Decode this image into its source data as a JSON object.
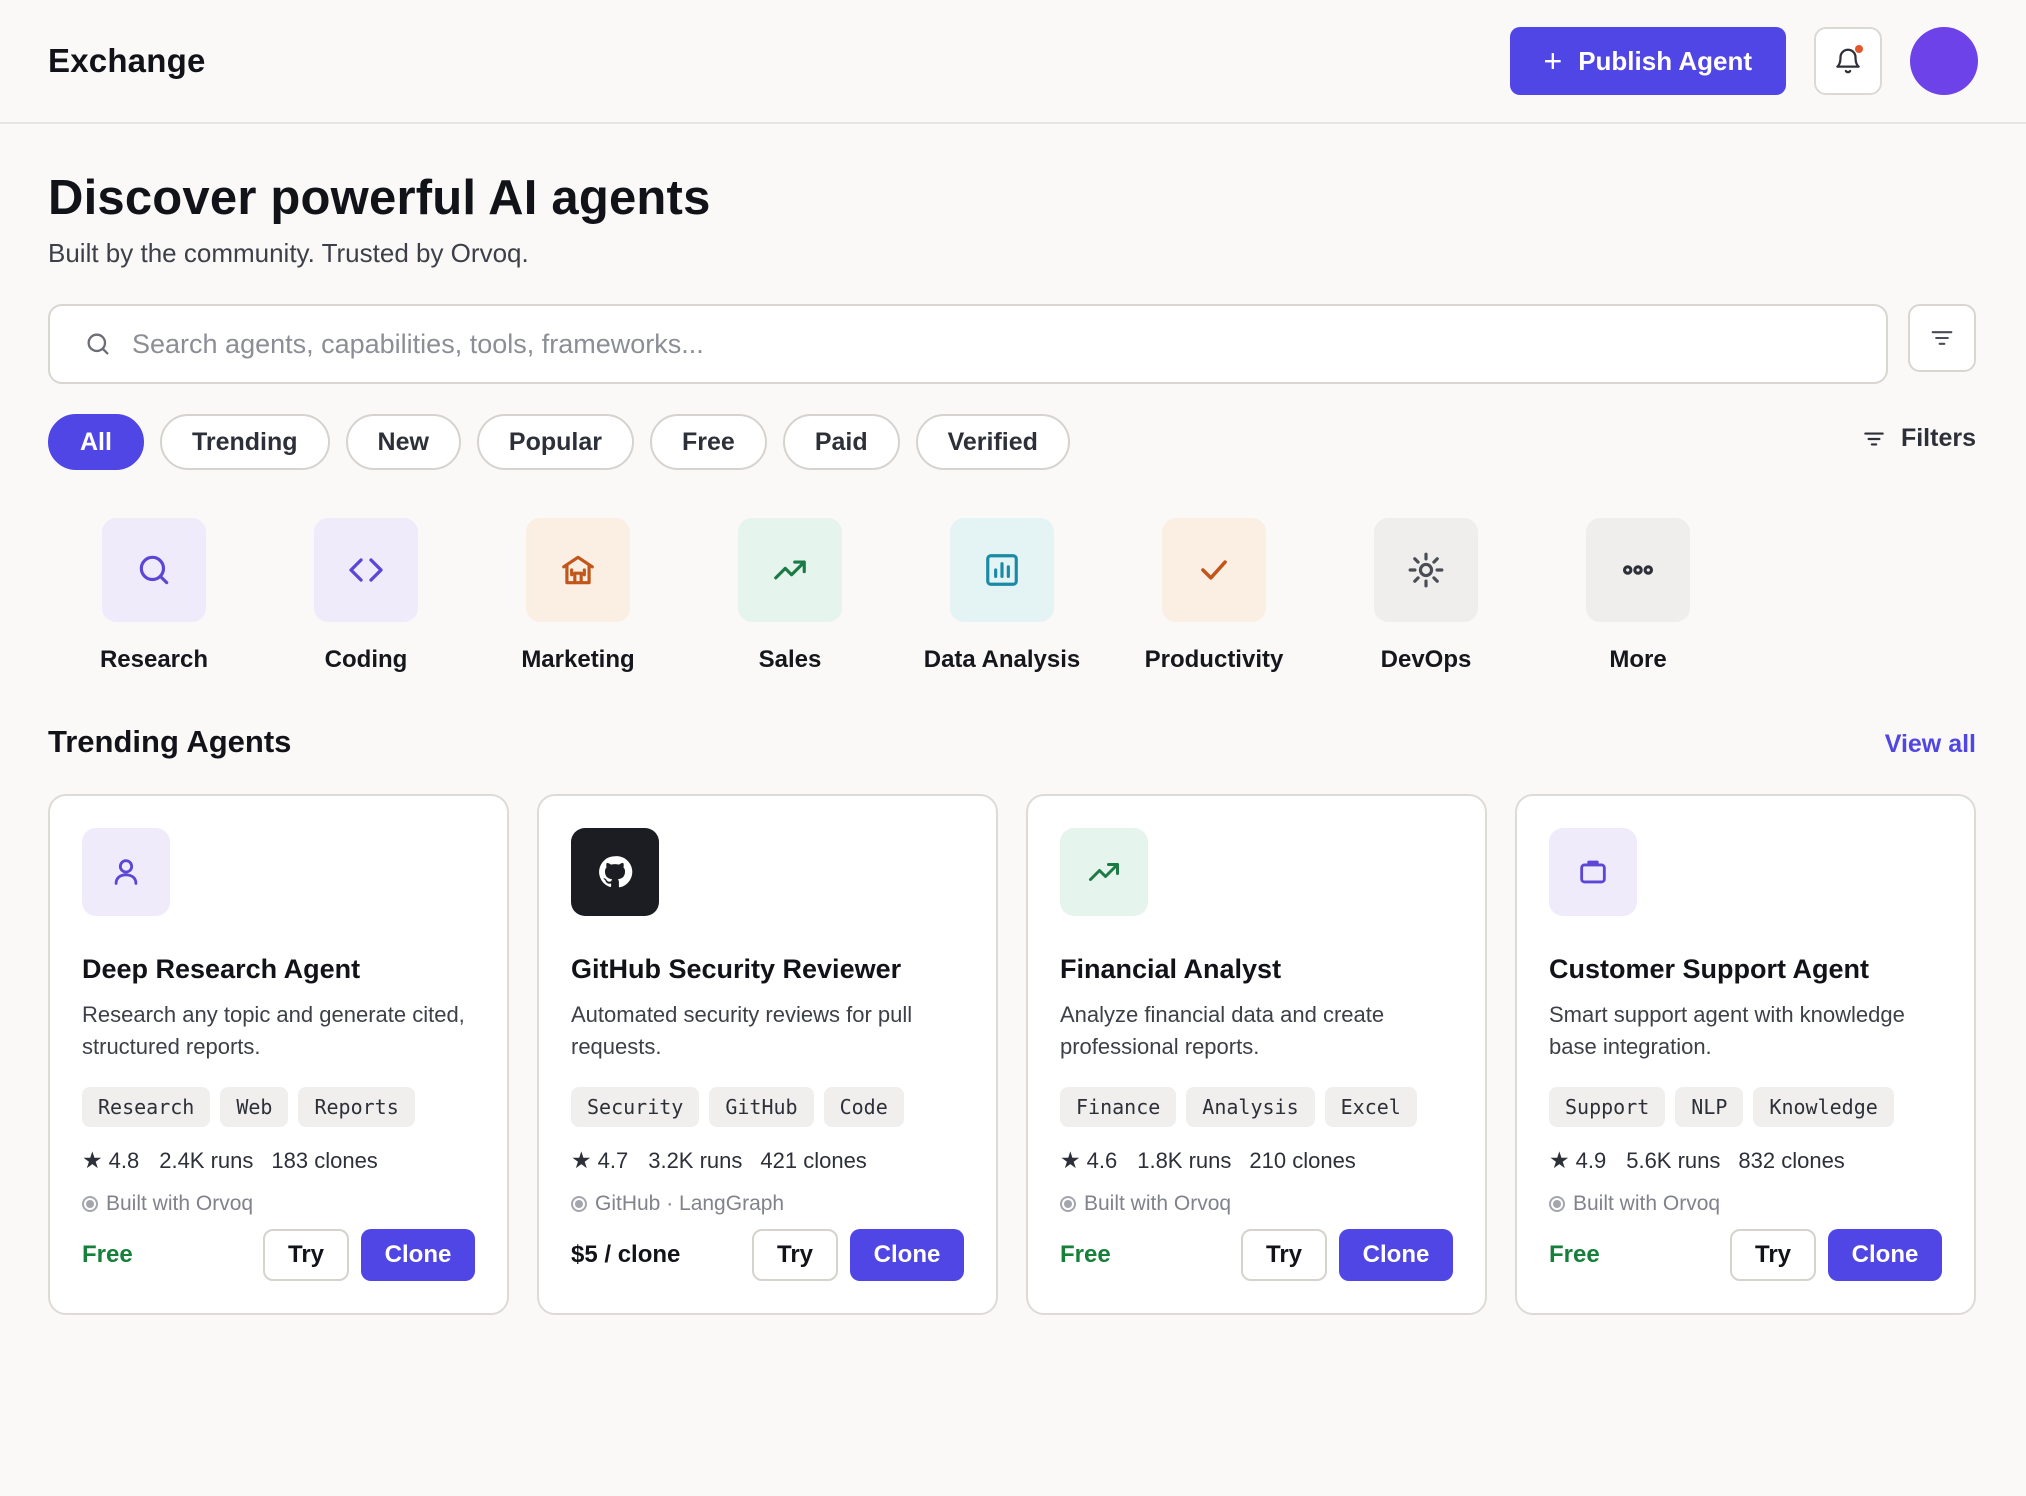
{
  "header": {
    "brand": "Exchange",
    "publish_label": "Publish Agent"
  },
  "hero": {
    "title": "Discover powerful AI agents",
    "subtitle": "Built by the community. Trusted by Orvoq."
  },
  "search": {
    "placeholder": "Search agents, capabilities, tools, frameworks..."
  },
  "chips": [
    {
      "label": "All",
      "active": true
    },
    {
      "label": "Trending"
    },
    {
      "label": "New"
    },
    {
      "label": "Popular"
    },
    {
      "label": "Free"
    },
    {
      "label": "Paid"
    },
    {
      "label": "Verified"
    }
  ],
  "filters_label": "Filters",
  "categories": [
    {
      "label": "Research",
      "icon": "search-icon",
      "bg": "#efebfb",
      "color": "#5b46d6"
    },
    {
      "label": "Coding",
      "icon": "code-icon",
      "bg": "#efebfb",
      "color": "#5b46d6"
    },
    {
      "label": "Marketing",
      "icon": "store-icon",
      "bg": "#fbeee3",
      "color": "#c2561a"
    },
    {
      "label": "Sales",
      "icon": "trending-up-icon",
      "bg": "#e6f4ee",
      "color": "#1d7a45"
    },
    {
      "label": "Data Analysis",
      "icon": "bar-chart-icon",
      "bg": "#e4f3f4",
      "color": "#1a8aa6"
    },
    {
      "label": "Productivity",
      "icon": "check-icon",
      "bg": "#fbeee3",
      "color": "#c2561a"
    },
    {
      "label": "DevOps",
      "icon": "gear-icon",
      "bg": "#efeeec",
      "color": "#4a4d55"
    },
    {
      "label": "More",
      "icon": "more-icon",
      "bg": "#efeeec",
      "color": "#4a4d55"
    }
  ],
  "section": {
    "title": "Trending Agents",
    "view_all": "View all"
  },
  "cards": [
    {
      "icon": "user-icon",
      "icon_bg": "#efebfb",
      "title": "Deep Research Agent",
      "desc": "Research any topic and generate cited, structured reports.",
      "tags": [
        "Research",
        "Web",
        "Reports"
      ],
      "rating": "4.8",
      "runs": "2.4K runs",
      "clones": "183 clones",
      "built": "Built with Orvoq",
      "price": "Free",
      "try_label": "Try",
      "clone_label": "Clone"
    },
    {
      "icon": "github-icon",
      "icon_bg": "#1b1d22",
      "title": "GitHub Security Reviewer",
      "desc": "Automated security reviews for pull requests.",
      "tags": [
        "Security",
        "GitHub",
        "Code"
      ],
      "rating": "4.7",
      "runs": "3.2K runs",
      "clones": "421 clones",
      "built": "GitHub · LangGraph",
      "price": "$5 / clone",
      "try_label": "Try",
      "clone_label": "Clone"
    },
    {
      "icon": "trending-up-icon",
      "icon_bg": "#e6f4ee",
      "title": "Financial Analyst",
      "desc": "Analyze financial data and create professional reports.",
      "tags": [
        "Finance",
        "Analysis",
        "Excel"
      ],
      "rating": "4.6",
      "runs": "1.8K runs",
      "clones": "210 clones",
      "built": "Built with Orvoq",
      "price": "Free",
      "try_label": "Try",
      "clone_label": "Clone"
    },
    {
      "icon": "briefcase-icon",
      "icon_bg": "#efebfb",
      "title": "Customer Support Agent",
      "desc": "Smart support agent with knowledge base integration.",
      "tags": [
        "Support",
        "NLP",
        "Knowledge"
      ],
      "rating": "4.9",
      "runs": "5.6K runs",
      "clones": "832 clones",
      "built": "Built with Orvoq",
      "price": "Free",
      "try_label": "Try",
      "clone_label": "Clone"
    }
  ]
}
